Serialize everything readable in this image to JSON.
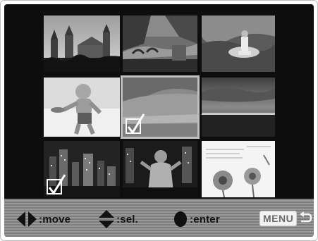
{
  "playback": {
    "thumbnails": [
      {
        "subject": "cathedral-towers",
        "checked": false,
        "cursor": false
      },
      {
        "subject": "stone-bridge",
        "checked": false,
        "cursor": false
      },
      {
        "subject": "child-in-water",
        "checked": false,
        "cursor": false
      },
      {
        "subject": "child-on-beach",
        "checked": false,
        "cursor": false
      },
      {
        "subject": "beach-hillside",
        "checked": true,
        "cursor": true
      },
      {
        "subject": "sunset-sea",
        "checked": false,
        "cursor": false
      },
      {
        "subject": "city-night",
        "checked": true,
        "cursor": false
      },
      {
        "subject": "woman-city-night",
        "checked": false,
        "cursor": false
      },
      {
        "subject": "flowers-text",
        "checked": false,
        "cursor": false
      }
    ]
  },
  "guide": {
    "move_label": ":move",
    "sel_label": ":sel.",
    "enter_label": ":enter",
    "menu_label": "MENU"
  },
  "colors": {
    "screen_bg": "#0d0d0d",
    "bar_bg": "#8a8a8a",
    "check": "#ffffff"
  }
}
